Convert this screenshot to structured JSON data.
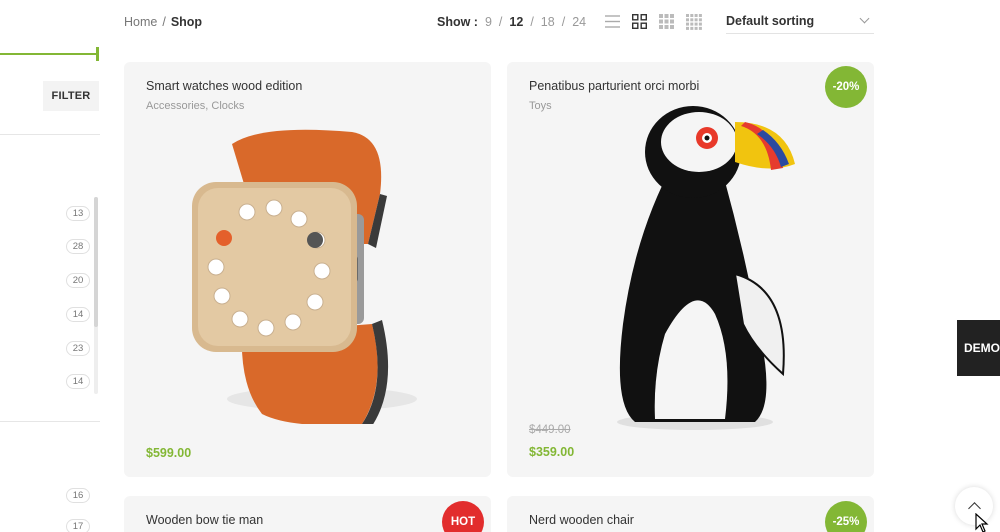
{
  "sidebar": {
    "filter_label": "FILTER",
    "counts_a": [
      "13",
      "28",
      "20",
      "14",
      "23",
      "14"
    ],
    "counts_b": [
      "16",
      "17"
    ]
  },
  "toolbar": {
    "breadcrumb": {
      "home": "Home",
      "separator": "/",
      "current": "Shop"
    },
    "show": {
      "label": "Show :",
      "options": [
        "9",
        "12",
        "18",
        "24"
      ],
      "active": "12",
      "separator": "/"
    },
    "view_modes": [
      "list-view-icon",
      "grid-2-icon",
      "grid-3-icon",
      "grid-4-icon"
    ],
    "active_view": "grid-2-icon",
    "sorting": {
      "value": "Default sorting"
    }
  },
  "products": [
    {
      "title": "Smart watches wood edition",
      "categories": "Accessories, Clocks",
      "price": "$599.00",
      "old_price": "",
      "badge": ""
    },
    {
      "title": "Penatibus parturient orci morbi",
      "categories": "Toys",
      "price": "$359.00",
      "old_price": "$449.00",
      "badge": "-20%"
    },
    {
      "title": "Wooden bow tie man",
      "categories": "",
      "price": "",
      "old_price": "",
      "badge": "HOT"
    },
    {
      "title": "Nerd wooden chair",
      "categories": "",
      "price": "",
      "old_price": "",
      "badge": "-25%"
    }
  ],
  "floating": {
    "demo_label": "DEMO"
  },
  "colors": {
    "accent": "#83b735",
    "hot": "#e22d2d",
    "card_bg": "#f5f5f5"
  }
}
